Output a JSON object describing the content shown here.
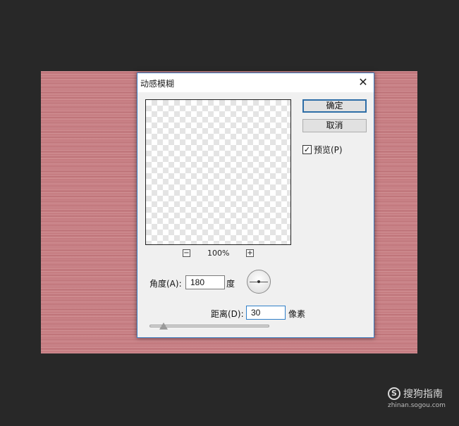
{
  "dialog": {
    "title": "动感模糊",
    "close_glyph": "✕",
    "zoom": {
      "minus_glyph": "−",
      "plus_glyph": "+",
      "level": "100%"
    },
    "buttons": {
      "ok_label": "确定",
      "cancel_label": "取消"
    },
    "preview_checkbox": {
      "label": "预览(P)",
      "checked": true,
      "check_glyph": "✓"
    },
    "angle": {
      "label": "角度(A):",
      "value": "180",
      "unit": "度"
    },
    "distance": {
      "label": "距离(D):",
      "value": "30",
      "unit": "像素",
      "slider_level_fraction": 0.12
    }
  },
  "watermark": {
    "brand": "搜狗指南",
    "logo_letter": "S",
    "url": "zhinan.sogou.com"
  },
  "colors": {
    "workspace_bg": "#282828",
    "canvas_texture": "#c97d82",
    "dialog_bg": "#f0f0f0",
    "accent_border": "#2e6ea7"
  }
}
